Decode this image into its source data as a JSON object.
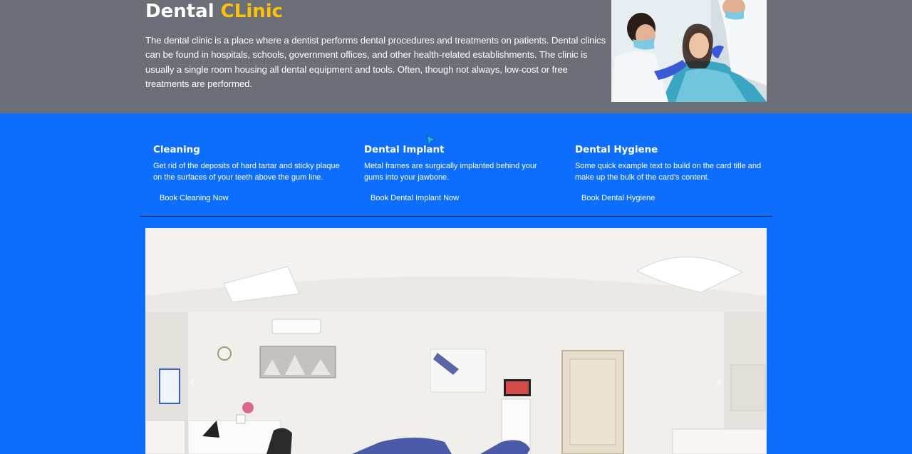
{
  "hero": {
    "title_main": "Dental ",
    "title_accent": "CLinic",
    "description": "The dental clinic is a place where a dentist performs dental procedures and treatments on patients. Dental clinics can be found in hospitals, schools, government offices, and other health-related establishments. The clinic is usually a single room housing all dental equipment and tools. Often, though not always, low-cost or free treatments are performed.",
    "image": "dentist-patient-photo"
  },
  "services": [
    {
      "title": "Cleaning",
      "text": "Get rid of the deposits of hard tartar and sticky plaque on the surfaces of your teeth above the gum line.",
      "button": "Book Cleaning Now"
    },
    {
      "title": "Dental Implant",
      "text": "Metal frames are surgically implanted behind your gums into your jawbone.",
      "button": "Book Dental Implant Now"
    },
    {
      "title": "Dental Hygiene",
      "text": "Some quick example text to build on the card title and make up the bulk of the card’s content.",
      "button": "Book Dental Hygiene"
    }
  ],
  "carousel": {
    "image": "clinic-panorama-photo",
    "prev_icon": "chevron-left-icon",
    "next_icon": "chevron-right-icon",
    "prev_glyph": "‹",
    "next_glyph": "›"
  },
  "colors": {
    "hero_bg": "#6c6f77",
    "services_bg": "#0d6efd",
    "accent": "#ffc107",
    "text": "#ffffff"
  }
}
